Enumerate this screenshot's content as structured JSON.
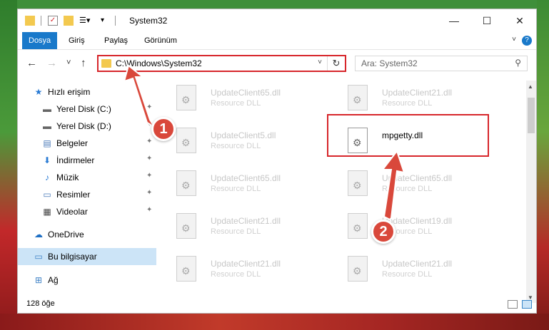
{
  "window": {
    "title": "System32",
    "controls": {
      "minimize": "—",
      "maximize": "☐",
      "close": "✕"
    }
  },
  "ribbon": {
    "tabs": [
      "Dosya",
      "Giriş",
      "Paylaş",
      "Görünüm"
    ],
    "active_tab": "Dosya",
    "help": "?"
  },
  "navigation": {
    "back": "←",
    "forward": "→",
    "recent": "˅",
    "up": "↑",
    "address": "C:\\Windows\\System32",
    "refresh": "↻",
    "search_placeholder": "Ara: System32"
  },
  "sidebar": {
    "items": [
      {
        "label": "Hızlı erişim",
        "icon": "star-icon"
      },
      {
        "label": "Yerel Disk (C:)",
        "icon": "drive-icon"
      },
      {
        "label": "Yerel Disk (D:)",
        "icon": "drive-icon"
      },
      {
        "label": "Belgeler",
        "icon": "documents-icon"
      },
      {
        "label": "İndirmeler",
        "icon": "download-icon"
      },
      {
        "label": "Müzik",
        "icon": "music-icon"
      },
      {
        "label": "Resimler",
        "icon": "pictures-icon"
      },
      {
        "label": "Videolar",
        "icon": "videos-icon"
      },
      {
        "label": "OneDrive",
        "icon": "cloud-icon"
      },
      {
        "label": "Bu bilgisayar",
        "icon": "computer-icon"
      },
      {
        "label": "Ağ",
        "icon": "network-icon"
      }
    ],
    "selected": "Bu bilgisayar"
  },
  "files": [
    {
      "name": "UpdateClient65.dll",
      "desc": "Resource DLL"
    },
    {
      "name": "UpdateClient21.dll",
      "desc": "Resource DLL"
    },
    {
      "name": "UpdateClient5.dll",
      "desc": "Resource DLL"
    },
    {
      "name": "mpgetty.dll",
      "desc": ""
    },
    {
      "name": "UpdateClient65.dll",
      "desc": "Resource DLL"
    },
    {
      "name": "UpdateClient65.dll",
      "desc": "Resource DLL"
    },
    {
      "name": "UpdateClient21.dll",
      "desc": "Resource DLL"
    },
    {
      "name": "UpdateClient19.dll",
      "desc": "Resource DLL"
    },
    {
      "name": "UpdateClient21.dll",
      "desc": "Resource DLL"
    },
    {
      "name": "UpdateClient21.dll",
      "desc": "Resource DLL"
    }
  ],
  "highlighted_file": "mpgetty.dll",
  "status": {
    "count": "128 öğe"
  },
  "annotations": {
    "step1": "1",
    "step2": "2",
    "color": "#d7262b"
  }
}
